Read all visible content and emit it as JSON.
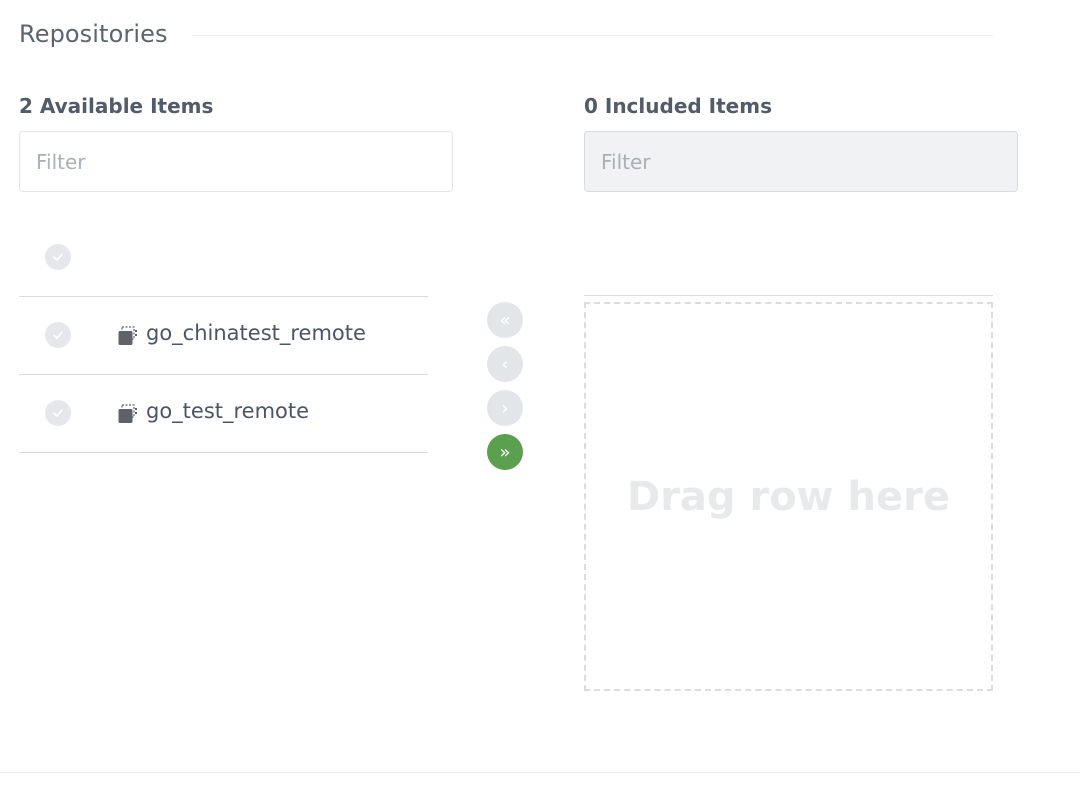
{
  "section": {
    "title": "Repositories"
  },
  "available": {
    "heading": "2 Available Items",
    "filter_placeholder": "Filter",
    "items": [
      {
        "name": "go_chinatest_remote"
      },
      {
        "name": "go_test_remote"
      }
    ]
  },
  "included": {
    "heading": "0 Included Items",
    "filter_placeholder": "Filter",
    "dropzone_label": "Drag row here"
  },
  "transfer_buttons": {
    "remove_all_glyph": "«",
    "remove_one_glyph": "‹",
    "add_one_glyph": "›",
    "add_all_glyph": "»"
  },
  "icons": {
    "check": "check-icon",
    "repo": "remote-repo-icon"
  },
  "colors": {
    "accent": "#5aa04e",
    "disabled_button": "#e3e6e9",
    "text": "#4a5568"
  }
}
